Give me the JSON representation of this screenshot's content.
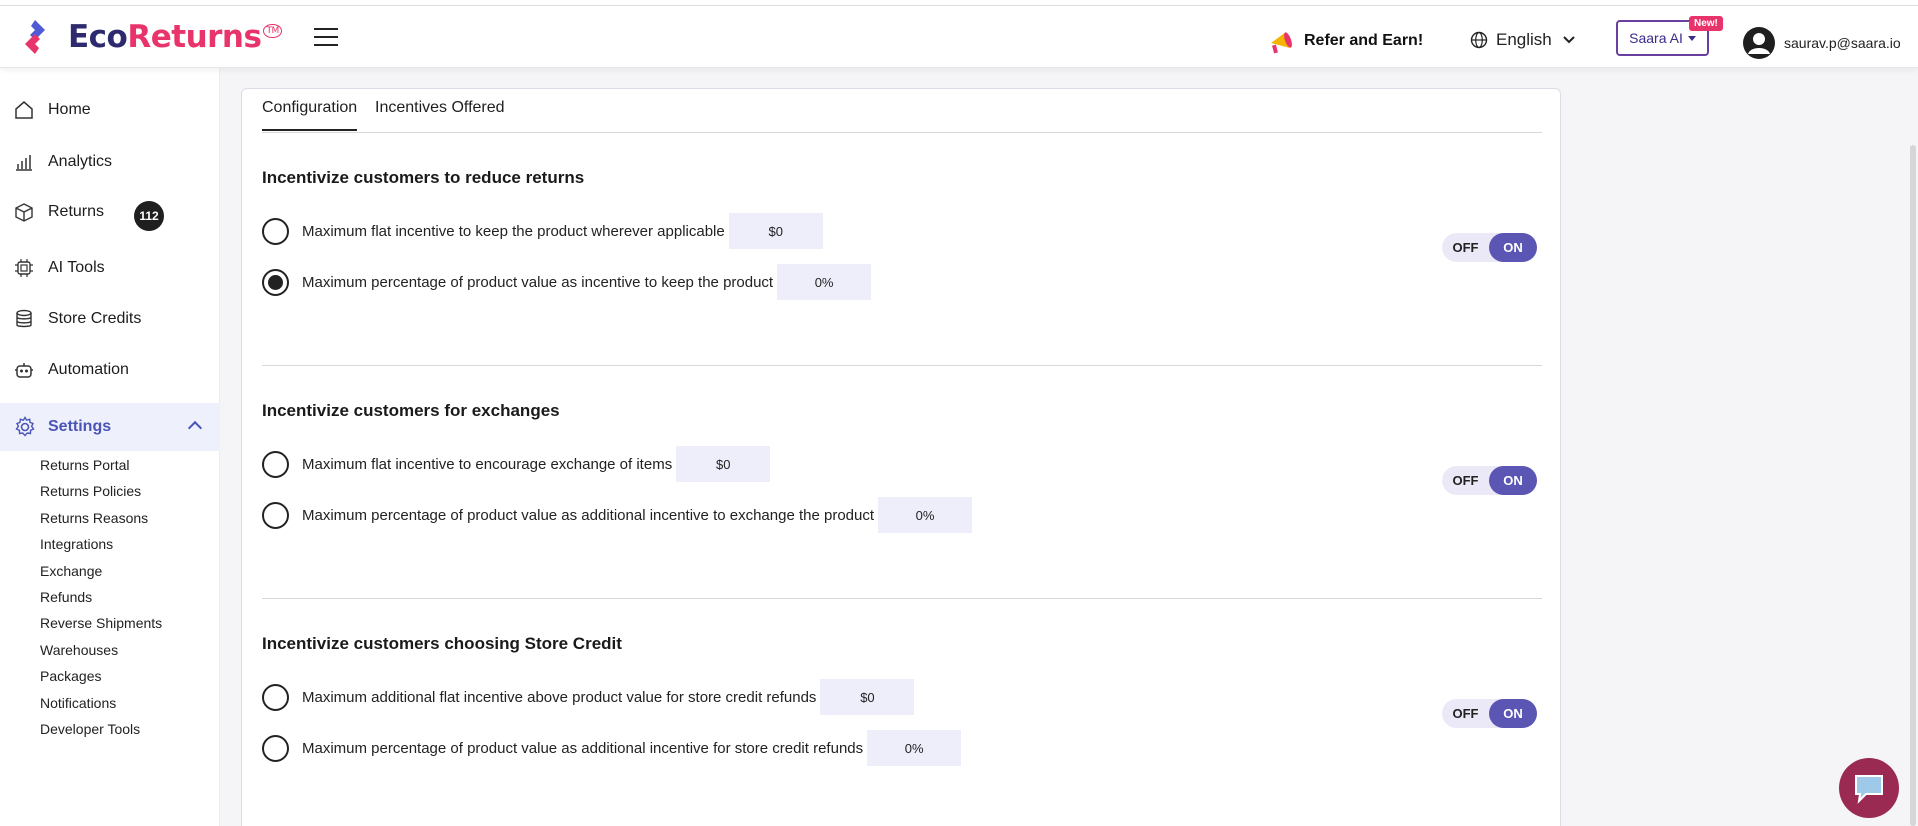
{
  "header": {
    "logo_eco": "Eco",
    "logo_returns": "Returns",
    "logo_tm": "TM",
    "refer_label": "Refer and Earn!",
    "language": "English",
    "saara_label": "Saara AI",
    "new_badge": "New!",
    "user_email": "saurav.p@saara.io"
  },
  "sidebar": {
    "home": "Home",
    "analytics": "Analytics",
    "returns": "Returns",
    "returns_badge": "112",
    "ai_tools": "AI Tools",
    "store_credits": "Store Credits",
    "automation": "Automation",
    "settings": "Settings",
    "sub_items": [
      "Returns Portal",
      "Returns Policies",
      "Returns Reasons",
      "Integrations",
      "Exchange",
      "Refunds",
      "Reverse Shipments",
      "Warehouses",
      "Packages",
      "Notifications",
      "Developer Tools"
    ]
  },
  "tabs": {
    "configuration": "Configuration",
    "incentives": "Incentives Offered"
  },
  "sections": [
    {
      "title": "Incentivize customers to reduce returns",
      "options": [
        {
          "label": "Maximum flat incentive to keep the product wherever applicable",
          "value": "$0",
          "selected": false
        },
        {
          "label": "Maximum percentage of product value as incentive to keep the product",
          "value": "0%",
          "selected": true
        }
      ],
      "toggle_off": "OFF",
      "toggle_on": "ON"
    },
    {
      "title": "Incentivize customers for exchanges",
      "options": [
        {
          "label": "Maximum flat incentive to encourage exchange of items",
          "value": "$0",
          "selected": false
        },
        {
          "label": "Maximum percentage of product value as additional incentive to exchange the product",
          "value": "0%",
          "selected": false
        }
      ],
      "toggle_off": "OFF",
      "toggle_on": "ON"
    },
    {
      "title": "Incentivize customers choosing Store Credit",
      "options": [
        {
          "label": "Maximum additional flat incentive above product value for store credit refunds",
          "value": "$0",
          "selected": false
        },
        {
          "label": "Maximum percentage of product value as additional incentive for store credit refunds",
          "value": "0%",
          "selected": false
        }
      ],
      "toggle_off": "OFF",
      "toggle_on": "ON"
    }
  ],
  "colors": {
    "brand_navy": "#2d2a6e",
    "brand_pink": "#e8336b",
    "accent_purple": "#5b55b4",
    "settings_active": "#4a55b8"
  }
}
